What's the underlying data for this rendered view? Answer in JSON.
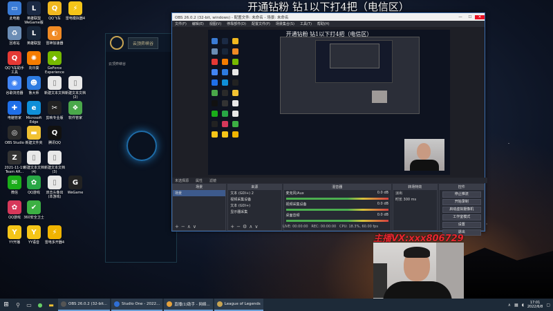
{
  "stream_title": "开通钻粉 钻1以下打4把（电信区）",
  "desktop_icons": [
    {
      "label": "此电脑",
      "color": "#3a7bd5",
      "glyph": "▭"
    },
    {
      "label": "英雄联盟\nWeGame版",
      "color": "#1b2a44",
      "glyph": "L"
    },
    {
      "label": "QQ飞车",
      "color": "#f1b81f",
      "glyph": "Q"
    },
    {
      "label": "雷电模拟器4",
      "color": "#f5c518",
      "glyph": "⚡"
    },
    {
      "label": "回收站",
      "color": "#6b8db5",
      "glyph": "♻"
    },
    {
      "label": "英雄联盟",
      "color": "#18263a",
      "glyph": "L"
    },
    {
      "label": "雷神加速器",
      "color": "#f08a24",
      "glyph": "◐"
    },
    {
      "label": "QQ飞车助手\n工具",
      "color": "#e53935",
      "glyph": "Q"
    },
    {
      "label": "向日葵",
      "color": "#f57c00",
      "glyph": "✺"
    },
    {
      "label": "GeForce\nExperience",
      "color": "#76b900",
      "glyph": "◆"
    },
    {
      "label": "谷歌浏览器",
      "color": "#4285f4",
      "glyph": "◉"
    },
    {
      "label": "鲁大师",
      "color": "#2d7be0",
      "glyph": "☻"
    },
    {
      "label": "新建文本文档",
      "color": "#e8e8e8",
      "glyph": "▯"
    },
    {
      "label": "新建文本文档\n(2)",
      "color": "#e8e8e8",
      "glyph": "▯"
    },
    {
      "label": "电脑管家",
      "color": "#1f6fe8",
      "glyph": "✚"
    },
    {
      "label": "Microsoft\nEdge",
      "color": "#0f8fd8",
      "glyph": "e"
    },
    {
      "label": "剪映专业版",
      "color": "#222222",
      "glyph": "✂"
    },
    {
      "label": "软件管家",
      "color": "#4aa84a",
      "glyph": "❖"
    },
    {
      "label": "OBS Studio",
      "color": "#2a2a2a",
      "glyph": "◎"
    },
    {
      "label": "新建文件夹",
      "color": "#f1c232",
      "glyph": "▬"
    },
    {
      "label": "腾讯QQ",
      "color": "#111111",
      "glyph": "Q"
    },
    {
      "label": "2021-11-19\nTeam AR...",
      "color": "#333333",
      "glyph": "Z"
    },
    {
      "label": "新建文本文档\n(4)",
      "color": "#e8e8e8",
      "glyph": "▯"
    },
    {
      "label": "新建文本文档\n(3)",
      "color": "#e8e8e8",
      "glyph": "▯"
    },
    {
      "label": "微信",
      "color": "#1aad19",
      "glyph": "✉"
    },
    {
      "label": "QQ游戏",
      "color": "#28a745",
      "glyph": "✿"
    },
    {
      "label": "双击头像出\n(本游戏)",
      "color": "#e8e8e8",
      "glyph": "▯"
    },
    {
      "label": "WeGame",
      "color": "#222222",
      "glyph": "G"
    },
    {
      "label": "QQ游戏",
      "color": "#d6385a",
      "glyph": "✿"
    },
    {
      "label": "360安全卫士",
      "color": "#3cb043",
      "glyph": "✔"
    },
    {
      "label": "YY开播",
      "color": "#f5c518",
      "glyph": "Y"
    },
    {
      "label": "YY语音",
      "color": "#f5c518",
      "glyph": "Y"
    },
    {
      "label": "雷电多开器4",
      "color": "#f0b400",
      "glyph": "⚡"
    }
  ],
  "lol_client": {
    "button": "云顶弈峡谷",
    "side_label": "云顶弈峡谷"
  },
  "obs": {
    "window_title": "OBS 26.0.2 (32-bit, windows) - 配置文件: 未命名 - 场景: 未命名",
    "menu": [
      "文件(F)",
      "编辑(E)",
      "视图(V)",
      "停靠部件(D)",
      "配置文件(P)",
      "场景集合(S)",
      "工具(T)",
      "帮助(H)"
    ],
    "preview_title": "开通钻粉 钻1以下打4把（电信区）",
    "status_line_source": "未选择源",
    "status_props": "属性",
    "status_filters": "滤镜",
    "docks": {
      "scenes": {
        "title": "场景",
        "items": [
          "场景"
        ]
      },
      "sources": {
        "title": "来源",
        "items": [
          "文本 (GDI+) 2",
          "视频采集设备",
          "文本 (GDI+)",
          "显示器采集"
        ]
      },
      "mixer": {
        "title": "混音器",
        "channels": [
          {
            "name": "麦克风/Aux",
            "db": "0.0 dB"
          },
          {
            "name": "视频采集设备",
            "db": "0.0 dB"
          },
          {
            "name": "桌面音频",
            "db": "0.0 dB"
          }
        ]
      },
      "transitions": {
        "title": "转场特效",
        "type": "淡出",
        "duration_label": "时长",
        "duration": "300 ms"
      },
      "controls": {
        "title": "控件",
        "buttons": [
          "停止推流",
          "开始录制",
          "启动虚拟摄像机",
          "工作室模式",
          "设置",
          "退出"
        ]
      }
    },
    "statusbar": {
      "live": "LIVE: 00:00:00",
      "rec": "REC: 00:00:00",
      "cpu": "CPU: 18.3%, 60.00 fps"
    }
  },
  "watermark": "主播VX:xxx806729",
  "taskbar": {
    "apps": [
      {
        "label": "OBS 26.0.2 (32-bit...",
        "color": "#555555"
      },
      {
        "label": "Studio One - 2022...",
        "color": "#2f6fd6"
      },
      {
        "label": "直播(1)助手 - 网络...",
        "color": "#e6a23c"
      },
      {
        "label": "League of Legends",
        "color": "#c8a452"
      }
    ],
    "time": "17:01",
    "date": "2022/6/8"
  }
}
